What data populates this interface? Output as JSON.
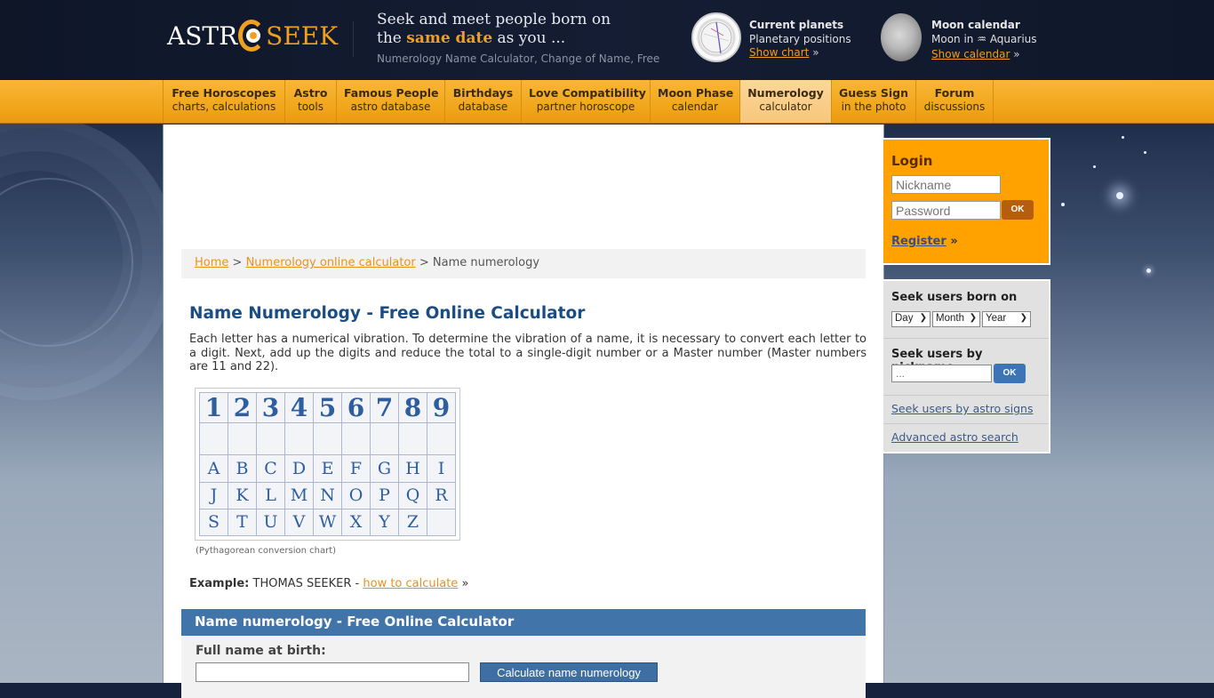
{
  "header": {
    "logo": {
      "part1": "ASTR",
      "part2": "SEEK"
    },
    "tagline_line1": "Seek and meet people born on",
    "tagline_pre": "the ",
    "tagline_highlight": "same date",
    "tagline_post": " as you ...",
    "subtitle": "Numerology Name Calculator, Change of Name, Free",
    "planets_widget": {
      "title": "Current planets",
      "subtitle": "Planetary positions",
      "link": "Show chart",
      "arrow": "»"
    },
    "moon_widget": {
      "title": "Moon calendar",
      "subtitle_pre": "Moon in ",
      "sign_glyph": "♒",
      "sign": "Aquarius",
      "link": "Show calendar",
      "arrow": "»"
    }
  },
  "nav": {
    "items": [
      {
        "title": "Free Horoscopes",
        "subtitle": "charts, calculations"
      },
      {
        "title": "Astro",
        "subtitle": "tools"
      },
      {
        "title": "Famous People",
        "subtitle": "astro database"
      },
      {
        "title": "Birthdays",
        "subtitle": "database"
      },
      {
        "title": "Love Compatibility",
        "subtitle": "partner horoscope"
      },
      {
        "title": "Moon Phase",
        "subtitle": "calendar"
      },
      {
        "title": "Numerology",
        "subtitle": "calculator"
      },
      {
        "title": "Guess Sign",
        "subtitle": "in the photo"
      },
      {
        "title": "Forum",
        "subtitle": "discussions"
      }
    ],
    "active_index": 6
  },
  "breadcrumb": {
    "home": "Home",
    "sep": ">",
    "parent": "Numerology online calculator",
    "current": "Name numerology"
  },
  "main": {
    "title": "Name Numerology - Free Online Calculator",
    "intro": "Each letter has a numerical vibration. To determine the vibration of a name, it is necessary to convert each letter to a digit. Next, add up the digits and reduce the total to a single-digit number or a Master number (Master numbers are 11 and 22).",
    "chart": {
      "numbers": [
        "1",
        "2",
        "3",
        "4",
        "5",
        "6",
        "7",
        "8",
        "9"
      ],
      "rows": [
        [
          "A",
          "B",
          "C",
          "D",
          "E",
          "F",
          "G",
          "H",
          "I"
        ],
        [
          "J",
          "K",
          "L",
          "M",
          "N",
          "O",
          "P",
          "Q",
          "R"
        ],
        [
          "S",
          "T",
          "U",
          "V",
          "W",
          "X",
          "Y",
          "Z",
          ""
        ]
      ],
      "caption": "(Pythagorean conversion chart)"
    },
    "example": {
      "label": "Example:",
      "name": "THOMAS SEEKER - ",
      "link": "how to calculate",
      "arrow": "»"
    },
    "calculator": {
      "header": "Name numerology - Free Online Calculator",
      "field_label": "Full name at birth:",
      "field_value": "",
      "button": "Calculate name numerology"
    }
  },
  "sidebar": {
    "login": {
      "title": "Login",
      "nickname_placeholder": "Nickname",
      "password_placeholder": "Password",
      "ok": "OK",
      "register": "Register",
      "register_arrow": "»"
    },
    "seek": {
      "born_title": "Seek users born on",
      "day": "Day",
      "month": "Month",
      "year": "Year",
      "nick_title": "Seek users by nickname",
      "nick_placeholder": "...",
      "ok": "OK",
      "link_signs": "Seek users by astro signs",
      "link_advanced": "Advanced astro search"
    }
  },
  "colors": {
    "accent_orange": "#f0a020",
    "nav_orange": "#f2a71c",
    "title_blue": "#1b4d85",
    "panel_blue": "#4174a8",
    "link_orange": "#e8921c"
  }
}
